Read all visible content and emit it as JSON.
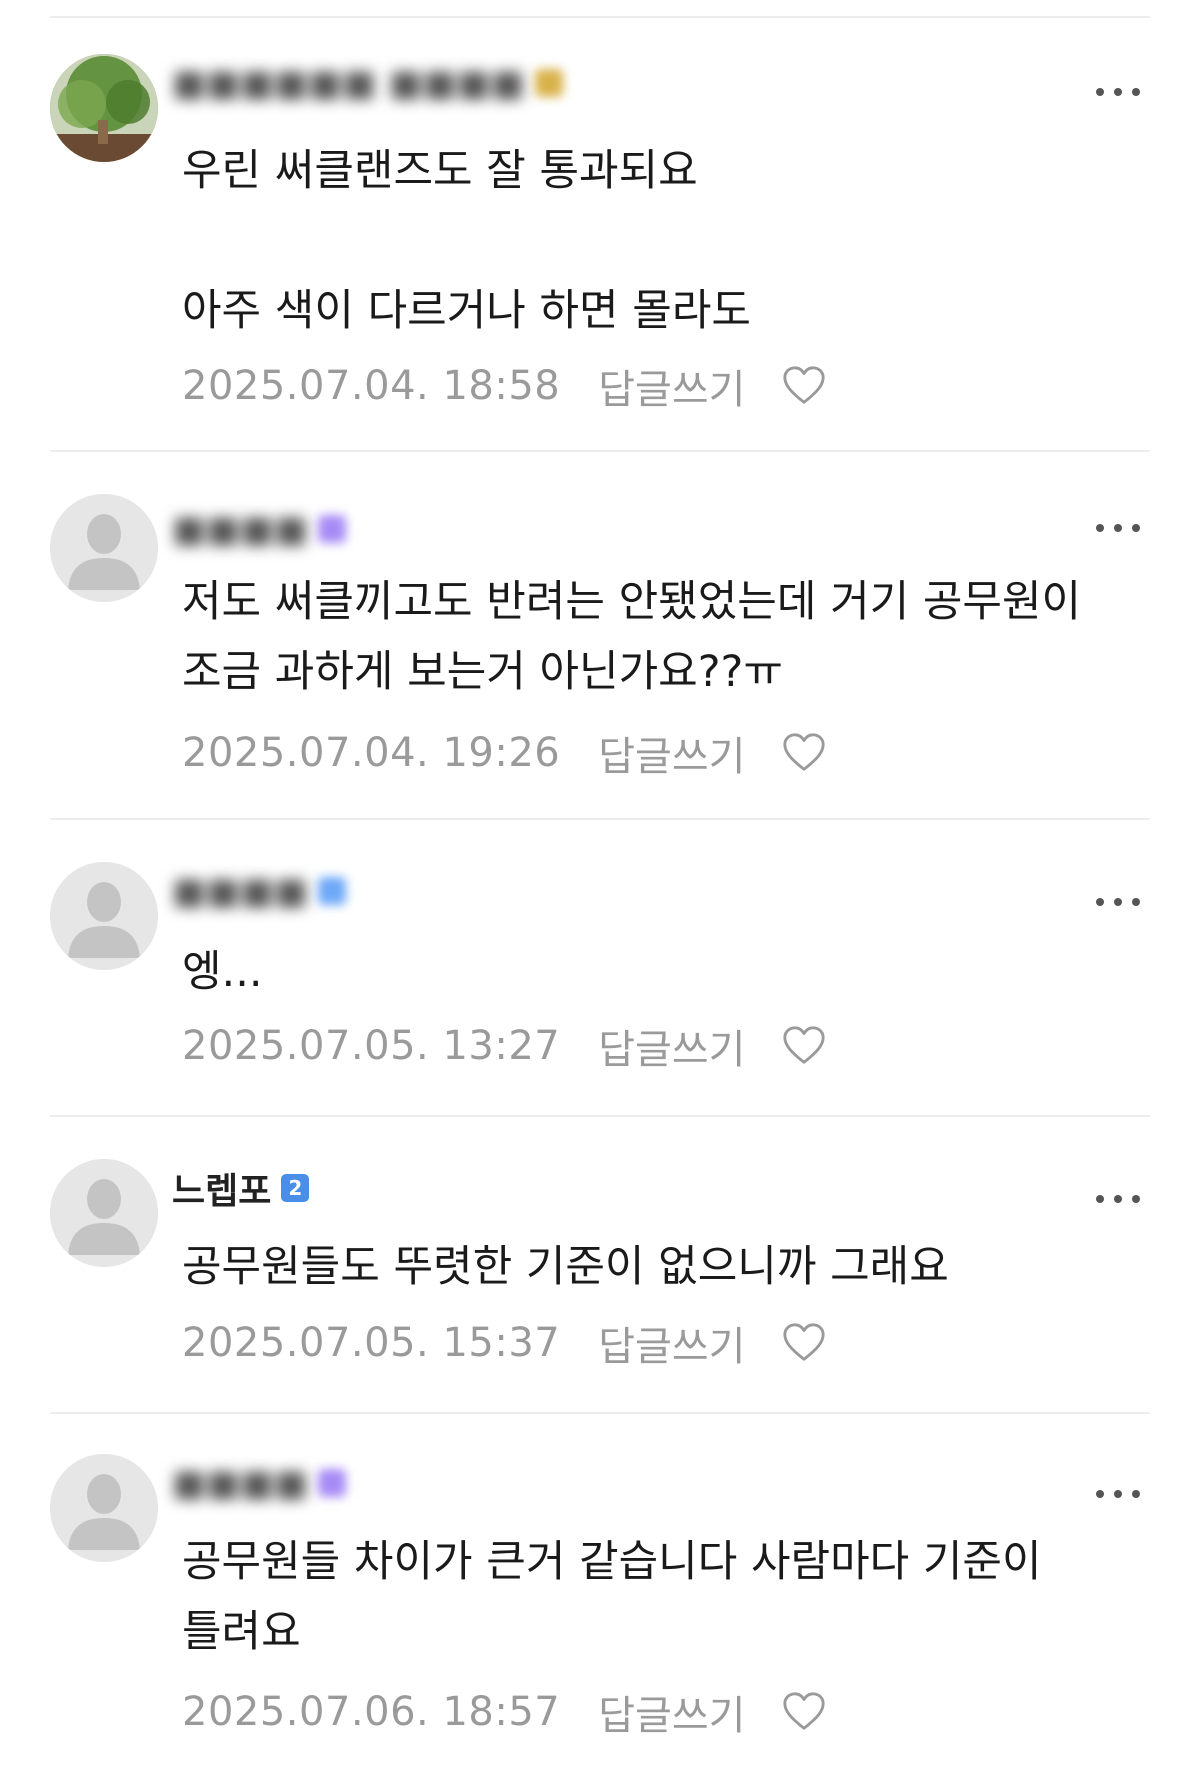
{
  "colors": {
    "badge_gold": "#d8b24a",
    "badge_purple": "#a78bf5",
    "badge_blue": "#6ea8f7",
    "badge_blue_dark": "#4a8ee8",
    "avatar_default": "#e6e6e6",
    "meta_gray": "#9a9a9a"
  },
  "comments": [
    {
      "nickname": "",
      "badge_icon": "level-badge-icon",
      "body": "우린 써클랜즈도 잘 통과되요\n\n아주 색이 다르거나 하면 몰라도",
      "date": "2025.07.04. 18:58",
      "reply_label": "답글쓰기",
      "avatar": "photo"
    },
    {
      "nickname": "",
      "badge_icon": "level-badge-icon",
      "body": "저도 써클끼고도 반려는 안됐었는데 거기 공무원이\n조금 과하게 보는거 아닌가요??ㅠ",
      "date": "2025.07.04. 19:26",
      "reply_label": "답글쓰기",
      "avatar": "default"
    },
    {
      "nickname": "",
      "badge_icon": "level-badge-icon",
      "body": "엥...",
      "date": "2025.07.05. 13:27",
      "reply_label": "답글쓰기",
      "avatar": "default"
    },
    {
      "nickname": "느렙포",
      "badge_text": "2",
      "badge_icon": "level-badge-icon",
      "body": "공무원들도 뚜렷한 기준이 없으니까 그래요",
      "date": "2025.07.05. 15:37",
      "reply_label": "답글쓰기",
      "avatar": "default"
    },
    {
      "nickname": "",
      "badge_icon": "level-badge-icon",
      "body": "공무원들 차이가 큰거 같습니다 사람마다 기준이\n틀려요",
      "date": "2025.07.06. 18:57",
      "reply_label": "답글쓰기",
      "avatar": "default"
    }
  ]
}
